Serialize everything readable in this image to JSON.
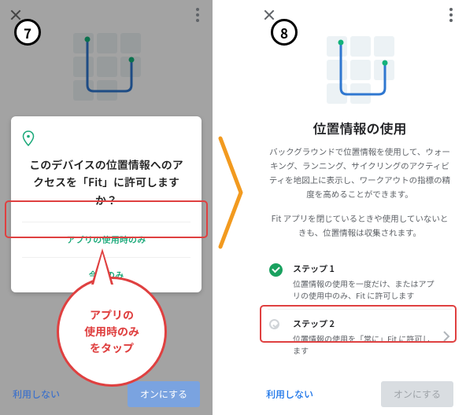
{
  "badges": {
    "left": "7",
    "right": "8"
  },
  "left": {
    "permission_question": "このデバイスの位置情報へのアクセスを「Fit」に許可しますか？",
    "option_while_using": "アプリの使用時のみ",
    "option_once": "今回のみ",
    "deny": "利用しない",
    "enable": "オンにする"
  },
  "callout": {
    "line1": "アプリの",
    "line2": "使用時のみ",
    "line3": "をタップ"
  },
  "right": {
    "title": "位置情報の使用",
    "description": "バックグラウンドで位置情報を使用して、ウォーキング、ランニング、サイクリングのアクティビティを地図上に表示し、ワークアウトの指標の精度を高めることができます。",
    "description2": "Fit アプリを閉じているときや使用していないときも、位置情報は収集されます。",
    "step1_title": "ステップ 1",
    "step1_sub": "位置情報の使用を一度だけ、またはアプリの使用中のみ、Fit に許可します",
    "step2_title": "ステップ 2",
    "step2_sub": "位置情報の使用を「常に」Fit に許可します",
    "deny": "利用しない",
    "enable": "オンにする"
  }
}
